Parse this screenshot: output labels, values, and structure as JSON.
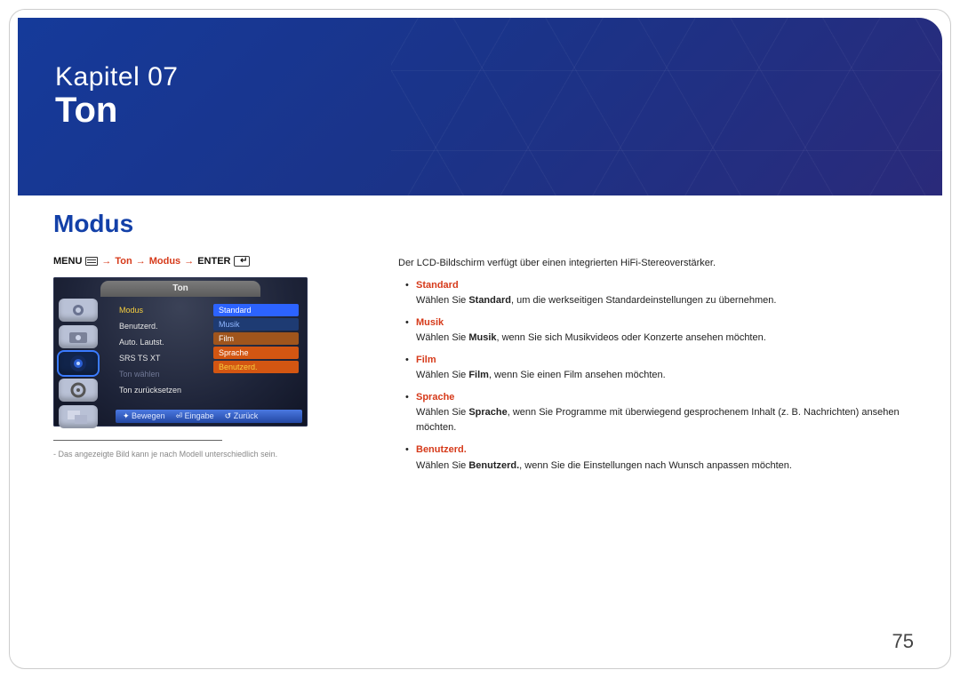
{
  "hero": {
    "chapter": "Kapitel 07",
    "title": "Ton"
  },
  "section_title": "Modus",
  "breadcrumb": {
    "menu": "MENU",
    "arrow": "→",
    "part1": "Ton",
    "part2": "Modus",
    "enter": "ENTER"
  },
  "osd": {
    "title": "Ton",
    "rows": [
      {
        "label": "Modus",
        "value": "Standard",
        "selected": true
      },
      {
        "label": "Benutzerd.",
        "value": "Musik"
      },
      {
        "label": "Auto. Lautst.",
        "value": "Film"
      },
      {
        "label": "SRS TS XT",
        "value": "Sprache"
      },
      {
        "label": "Ton wählen",
        "value": "Benutzerd.",
        "disabled": true
      },
      {
        "label": "Ton zurücksetzen"
      }
    ],
    "bottom": {
      "move": "Bewegen",
      "enter": "Eingabe",
      "back": "Zurück"
    }
  },
  "footnote": "Das angezeigte Bild kann je nach Modell unterschiedlich sein.",
  "content": {
    "intro": "Der LCD-Bildschirm verfügt über einen integrierten HiFi-Stereoverstärker.",
    "items": [
      {
        "label": "Standard",
        "body_before": "Wählen Sie ",
        "body_bold": "Standard",
        "body_after": ", um die werkseitigen Standardeinstellungen zu übernehmen."
      },
      {
        "label": "Musik",
        "body_before": "Wählen Sie ",
        "body_bold": "Musik",
        "body_after": ", wenn Sie sich Musikvideos oder Konzerte ansehen möchten."
      },
      {
        "label": "Film",
        "body_before": "Wählen Sie ",
        "body_bold": "Film",
        "body_after": ", wenn Sie einen Film ansehen möchten."
      },
      {
        "label": "Sprache",
        "body_before": "Wählen Sie ",
        "body_bold": "Sprache",
        "body_after": ", wenn Sie Programme mit überwiegend gesprochenem Inhalt (z. B. Nachrichten) ansehen möchten."
      },
      {
        "label": "Benutzerd.",
        "body_before": "Wählen Sie ",
        "body_bold": "Benutzerd.",
        "body_after": ", wenn Sie die Einstellungen nach Wunsch anpassen möchten."
      }
    ]
  },
  "page_number": "75"
}
